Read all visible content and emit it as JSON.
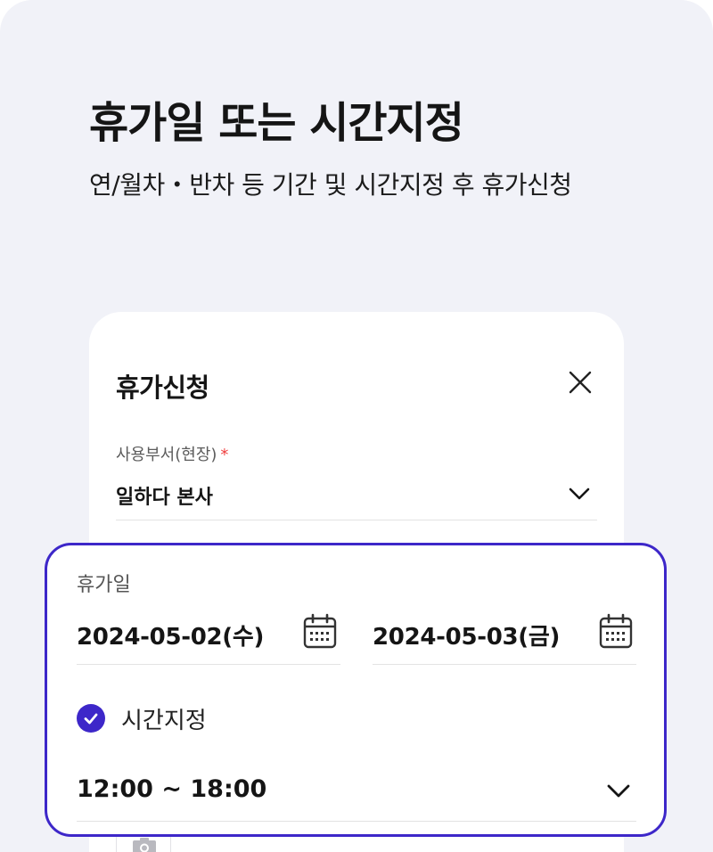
{
  "promo": {
    "headline": "휴가일 또는 시간지정",
    "subheadline": "연/월차・반차 등 기간 및 시간지정 후 휴가신청"
  },
  "modal": {
    "title": "휴가신청",
    "department": {
      "label": "사용부서(현장)",
      "required_mark": "*",
      "value": "일하다 본사"
    }
  },
  "leave": {
    "label": "휴가일",
    "start_date": "2024-05-02(수)",
    "end_date": "2024-05-03(금)",
    "time_toggle": {
      "label": "시간지정",
      "checked": true
    },
    "time_range": "12:00 ~ 18:00"
  },
  "colors": {
    "accent": "#3d27c9",
    "required": "#ef3f3f",
    "background": "#f1f2f8"
  },
  "icons": [
    "close-icon",
    "chevron-down-icon",
    "calendar-icon",
    "check-icon",
    "camera-icon"
  ]
}
